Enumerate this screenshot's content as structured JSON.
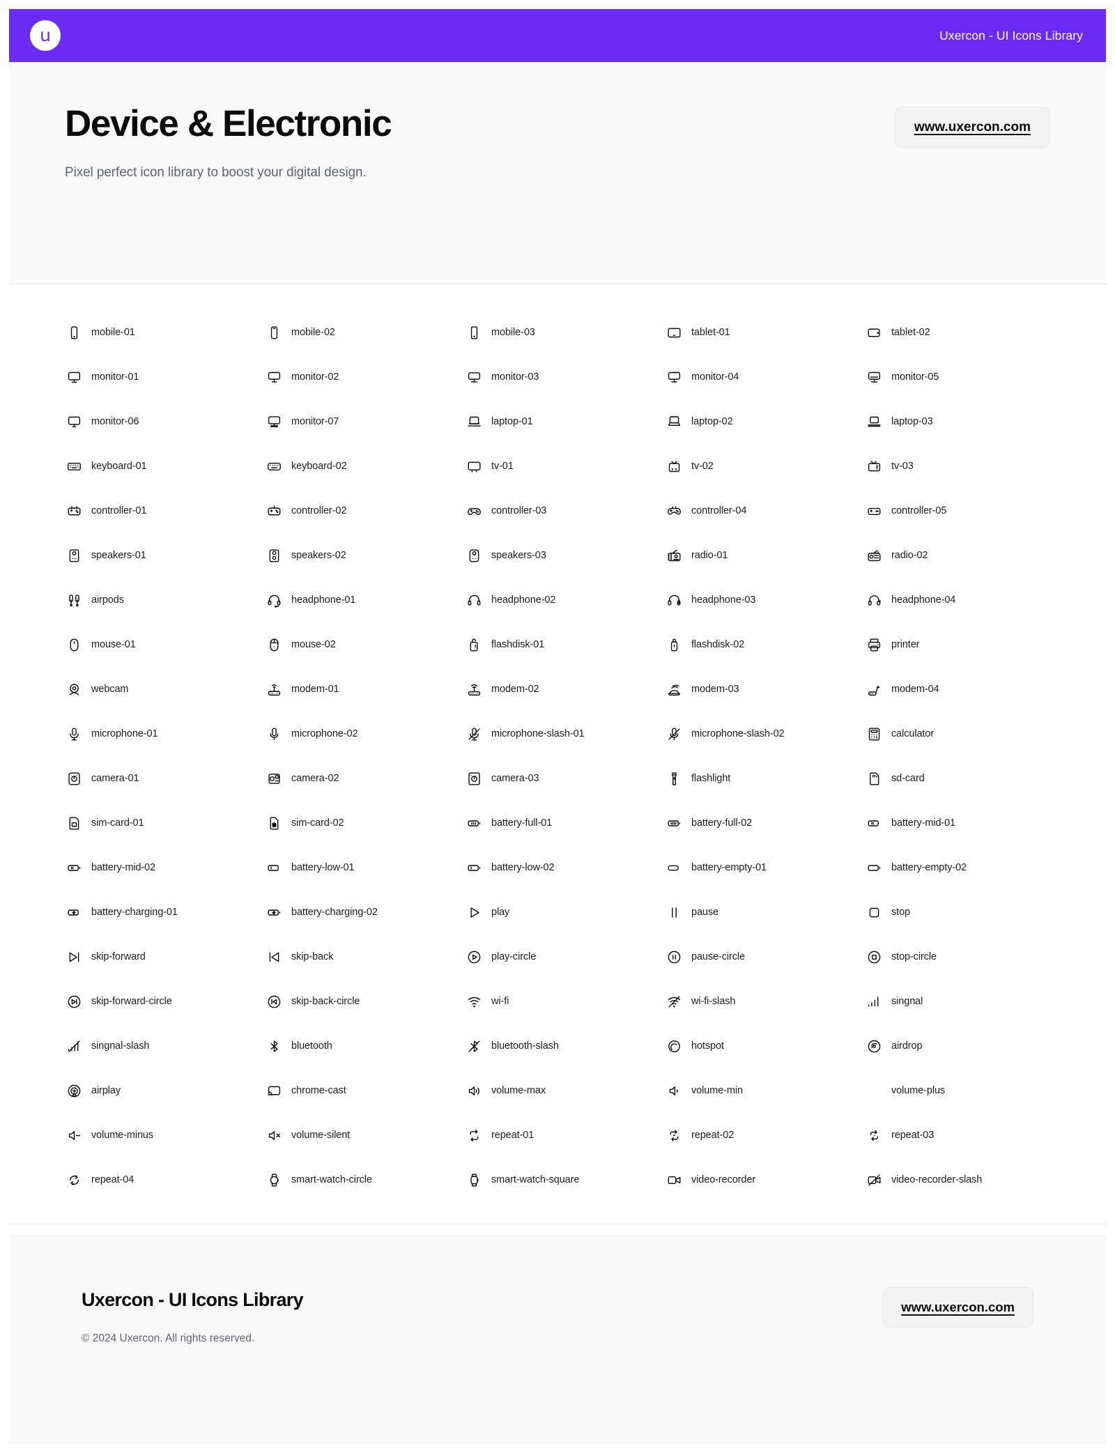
{
  "theme": {
    "brand_color": "#6C2BF2",
    "hero_bg": "#F9F9F9",
    "text_color": "#1D1D21",
    "muted_text": "#5D6470"
  },
  "topbar": {
    "logo_glyph": "u",
    "logo_icon_name": "uxercon-logo-icon",
    "title": "Uxercon - UI Icons Library"
  },
  "hero": {
    "title": "Device & Electronic",
    "subtitle": "Pixel perfect icon library to boost your digital design.",
    "url_button": "www.uxercon.com"
  },
  "footer": {
    "title": "Uxercon - UI Icons Library",
    "copyright": "© 2024 Uxercon. All rights reserved.",
    "url_button": "www.uxercon.com"
  },
  "grid": {
    "columns": 5,
    "icons": [
      {
        "label": "mobile-01",
        "icon": "mobile-01-icon"
      },
      {
        "label": "mobile-02",
        "icon": "mobile-02-icon"
      },
      {
        "label": "mobile-03",
        "icon": "mobile-03-icon"
      },
      {
        "label": "tablet-01",
        "icon": "tablet-01-icon"
      },
      {
        "label": "tablet-02",
        "icon": "tablet-02-icon"
      },
      {
        "label": "monitor-01",
        "icon": "monitor-01-icon"
      },
      {
        "label": "monitor-02",
        "icon": "monitor-02-icon"
      },
      {
        "label": "monitor-03",
        "icon": "monitor-03-icon"
      },
      {
        "label": "monitor-04",
        "icon": "monitor-04-icon"
      },
      {
        "label": "monitor-05",
        "icon": "monitor-05-icon"
      },
      {
        "label": "monitor-06",
        "icon": "monitor-06-icon"
      },
      {
        "label": "monitor-07",
        "icon": "monitor-07-icon"
      },
      {
        "label": "laptop-01",
        "icon": "laptop-01-icon"
      },
      {
        "label": "laptop-02",
        "icon": "laptop-02-icon"
      },
      {
        "label": "laptop-03",
        "icon": "laptop-03-icon"
      },
      {
        "label": "keyboard-01",
        "icon": "keyboard-01-icon"
      },
      {
        "label": "keyboard-02",
        "icon": "keyboard-02-icon"
      },
      {
        "label": "tv-01",
        "icon": "tv-01-icon"
      },
      {
        "label": "tv-02",
        "icon": "tv-02-icon"
      },
      {
        "label": "tv-03",
        "icon": "tv-03-icon"
      },
      {
        "label": "controller-01",
        "icon": "controller-01-icon"
      },
      {
        "label": "controller-02",
        "icon": "controller-02-icon"
      },
      {
        "label": "controller-03",
        "icon": "controller-03-icon"
      },
      {
        "label": "controller-04",
        "icon": "controller-04-icon"
      },
      {
        "label": "controller-05",
        "icon": "controller-05-icon"
      },
      {
        "label": "speakers-01",
        "icon": "speakers-01-icon"
      },
      {
        "label": "speakers-02",
        "icon": "speakers-02-icon"
      },
      {
        "label": "speakers-03",
        "icon": "speakers-03-icon"
      },
      {
        "label": "radio-01",
        "icon": "radio-01-icon"
      },
      {
        "label": "radio-02",
        "icon": "radio-02-icon"
      },
      {
        "label": "airpods",
        "icon": "airpods-icon"
      },
      {
        "label": "headphone-01",
        "icon": "headphone-01-icon"
      },
      {
        "label": "headphone-02",
        "icon": "headphone-02-icon"
      },
      {
        "label": "headphone-03",
        "icon": "headphone-03-icon"
      },
      {
        "label": "headphone-04",
        "icon": "headphone-04-icon"
      },
      {
        "label": "mouse-01",
        "icon": "mouse-01-icon"
      },
      {
        "label": "mouse-02",
        "icon": "mouse-02-icon"
      },
      {
        "label": "flashdisk-01",
        "icon": "flashdisk-01-icon"
      },
      {
        "label": "flashdisk-02",
        "icon": "flashdisk-02-icon"
      },
      {
        "label": "printer",
        "icon": "printer-icon"
      },
      {
        "label": "webcam",
        "icon": "webcam-icon"
      },
      {
        "label": "modem-01",
        "icon": "modem-01-icon"
      },
      {
        "label": "modem-02",
        "icon": "modem-02-icon"
      },
      {
        "label": "modem-03",
        "icon": "modem-03-icon"
      },
      {
        "label": "modem-04",
        "icon": "modem-04-icon"
      },
      {
        "label": "microphone-01",
        "icon": "microphone-01-icon"
      },
      {
        "label": "microphone-02",
        "icon": "microphone-02-icon"
      },
      {
        "label": "microphone-slash-01",
        "icon": "microphone-slash-01-icon"
      },
      {
        "label": "microphone-slash-02",
        "icon": "microphone-slash-02-icon"
      },
      {
        "label": "calculator",
        "icon": "calculator-icon"
      },
      {
        "label": "camera-01",
        "icon": "camera-01-icon"
      },
      {
        "label": "camera-02",
        "icon": "camera-02-icon"
      },
      {
        "label": "camera-03",
        "icon": "camera-03-icon"
      },
      {
        "label": "flashlight",
        "icon": "flashlight-icon"
      },
      {
        "label": "sd-card",
        "icon": "sd-card-icon"
      },
      {
        "label": "sim-card-01",
        "icon": "sim-card-01-icon"
      },
      {
        "label": "sim-card-02",
        "icon": "sim-card-02-icon"
      },
      {
        "label": "battery-full-01",
        "icon": "battery-full-01-icon"
      },
      {
        "label": "battery-full-02",
        "icon": "battery-full-02-icon"
      },
      {
        "label": "battery-mid-01",
        "icon": "battery-mid-01-icon"
      },
      {
        "label": "battery-mid-02",
        "icon": "battery-mid-02-icon"
      },
      {
        "label": "battery-low-01",
        "icon": "battery-low-01-icon"
      },
      {
        "label": "battery-low-02",
        "icon": "battery-low-02-icon"
      },
      {
        "label": "battery-empty-01",
        "icon": "battery-empty-01-icon"
      },
      {
        "label": "battery-empty-02",
        "icon": "battery-empty-02-icon"
      },
      {
        "label": "battery-charging-01",
        "icon": "battery-charging-01-icon"
      },
      {
        "label": "battery-charging-02",
        "icon": "battery-charging-02-icon"
      },
      {
        "label": "play",
        "icon": "play-icon"
      },
      {
        "label": "pause",
        "icon": "pause-icon"
      },
      {
        "label": "stop",
        "icon": "stop-icon"
      },
      {
        "label": "skip-forward",
        "icon": "skip-forward-icon"
      },
      {
        "label": "skip-back",
        "icon": "skip-back-icon"
      },
      {
        "label": "play-circle",
        "icon": "play-circle-icon"
      },
      {
        "label": "pause-circle",
        "icon": "pause-circle-icon"
      },
      {
        "label": "stop-circle",
        "icon": "stop-circle-icon"
      },
      {
        "label": "skip-forward-circle",
        "icon": "skip-forward-circle-icon"
      },
      {
        "label": "skip-back-circle",
        "icon": "skip-back-circle-icon"
      },
      {
        "label": "wi-fi",
        "icon": "wi-fi-icon"
      },
      {
        "label": "wi-fi-slash",
        "icon": "wi-fi-slash-icon"
      },
      {
        "label": "singnal",
        "icon": "signal-icon"
      },
      {
        "label": "singnal-slash",
        "icon": "signal-slash-icon"
      },
      {
        "label": "bluetooth",
        "icon": "bluetooth-icon"
      },
      {
        "label": "bluetooth-slash",
        "icon": "bluetooth-slash-icon"
      },
      {
        "label": "hotspot",
        "icon": "hotspot-icon"
      },
      {
        "label": "airdrop",
        "icon": "airdrop-icon"
      },
      {
        "label": "airplay",
        "icon": "airplay-icon"
      },
      {
        "label": "chrome-cast",
        "icon": "chrome-cast-icon"
      },
      {
        "label": "volume-max",
        "icon": "volume-max-icon"
      },
      {
        "label": "volume-min",
        "icon": "volume-min-icon"
      },
      {
        "label": "volume-plus",
        "icon": ""
      },
      {
        "label": "volume-minus",
        "icon": "volume-minus-icon"
      },
      {
        "label": "volume-silent",
        "icon": "volume-silent-icon"
      },
      {
        "label": "repeat-01",
        "icon": "repeat-01-icon"
      },
      {
        "label": "repeat-02",
        "icon": "repeat-02-icon"
      },
      {
        "label": "repeat-03",
        "icon": "repeat-03-icon"
      },
      {
        "label": "repeat-04",
        "icon": "repeat-04-icon"
      },
      {
        "label": "smart-watch-circle",
        "icon": "smart-watch-circle-icon"
      },
      {
        "label": "smart-watch-square",
        "icon": "smart-watch-square-icon"
      },
      {
        "label": "video-recorder",
        "icon": "video-recorder-icon"
      },
      {
        "label": "video-recorder-slash",
        "icon": "video-recorder-slash-icon"
      }
    ]
  }
}
